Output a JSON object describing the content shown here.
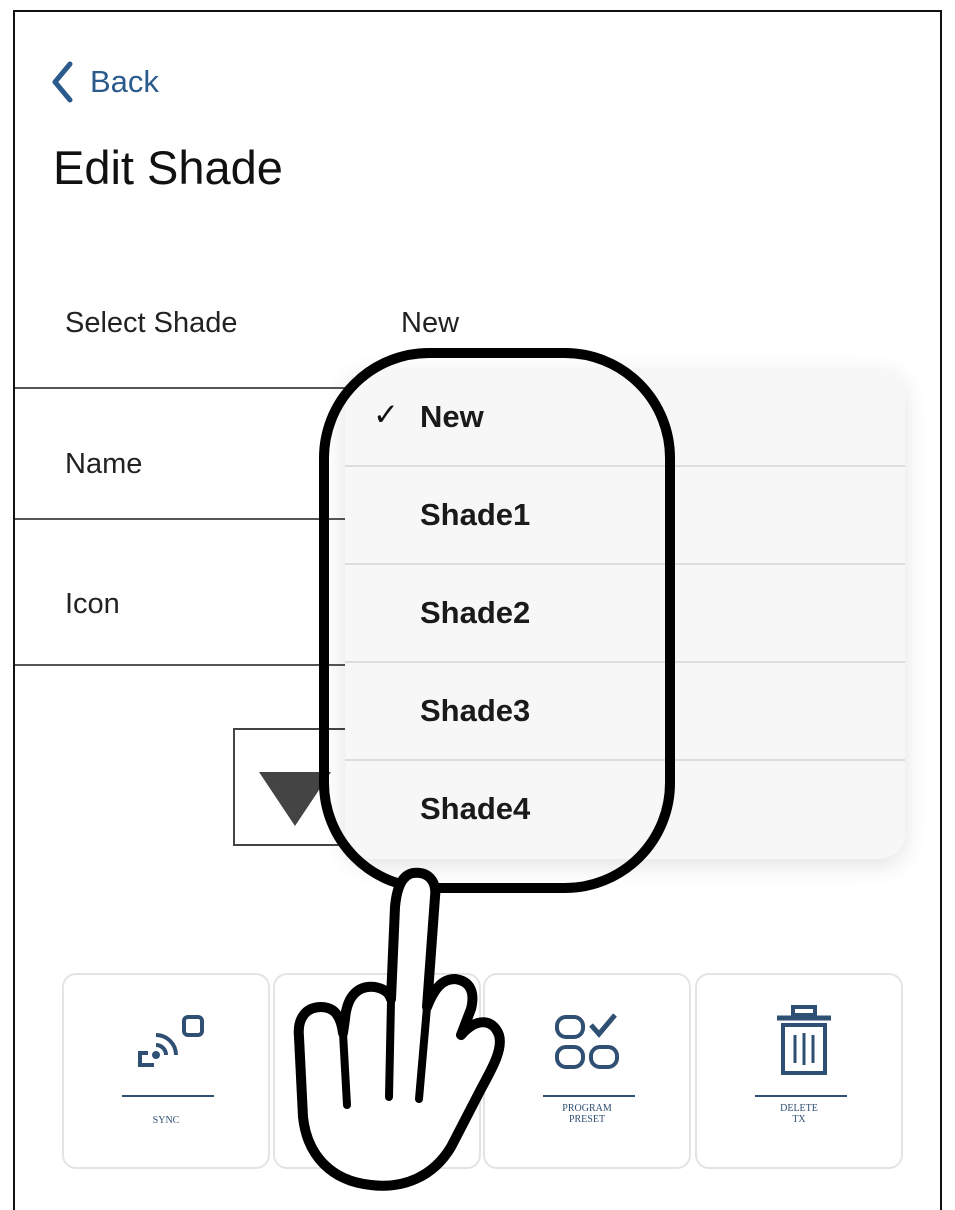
{
  "nav": {
    "back_label": "Back",
    "back_icon": "chevron-left-icon"
  },
  "page": {
    "title": "Edit Shade"
  },
  "form": {
    "select_shade": {
      "label": "Select Shade",
      "value": "New"
    },
    "name": {
      "label": "Name"
    },
    "icon": {
      "label": "Icon",
      "dropdown_icon": "triangle-down-icon"
    }
  },
  "dropdown": {
    "items": [
      {
        "label": "New",
        "selected": true,
        "check": "✓"
      },
      {
        "label": "Shade1",
        "selected": false
      },
      {
        "label": "Shade2",
        "selected": false
      },
      {
        "label": "Shade3",
        "selected": false
      },
      {
        "label": "Shade4",
        "selected": false
      }
    ]
  },
  "actions": [
    {
      "label": "SYNC",
      "icon": "sync-signal-icon"
    },
    {
      "label": "",
      "icon": "hidden-icon"
    },
    {
      "label_line1": "PROGRAM",
      "label_line2": "PRESET",
      "icon": "program-preset-icon"
    },
    {
      "label_line1": "DELETE",
      "label_line2": "TX",
      "icon": "trash-icon"
    }
  ],
  "overlay": {
    "hand_icon": "pointing-hand-icon"
  },
  "colors": {
    "accent": "#2a5b8c",
    "icon_blue": "#2f4f73",
    "outline": "#000000"
  }
}
